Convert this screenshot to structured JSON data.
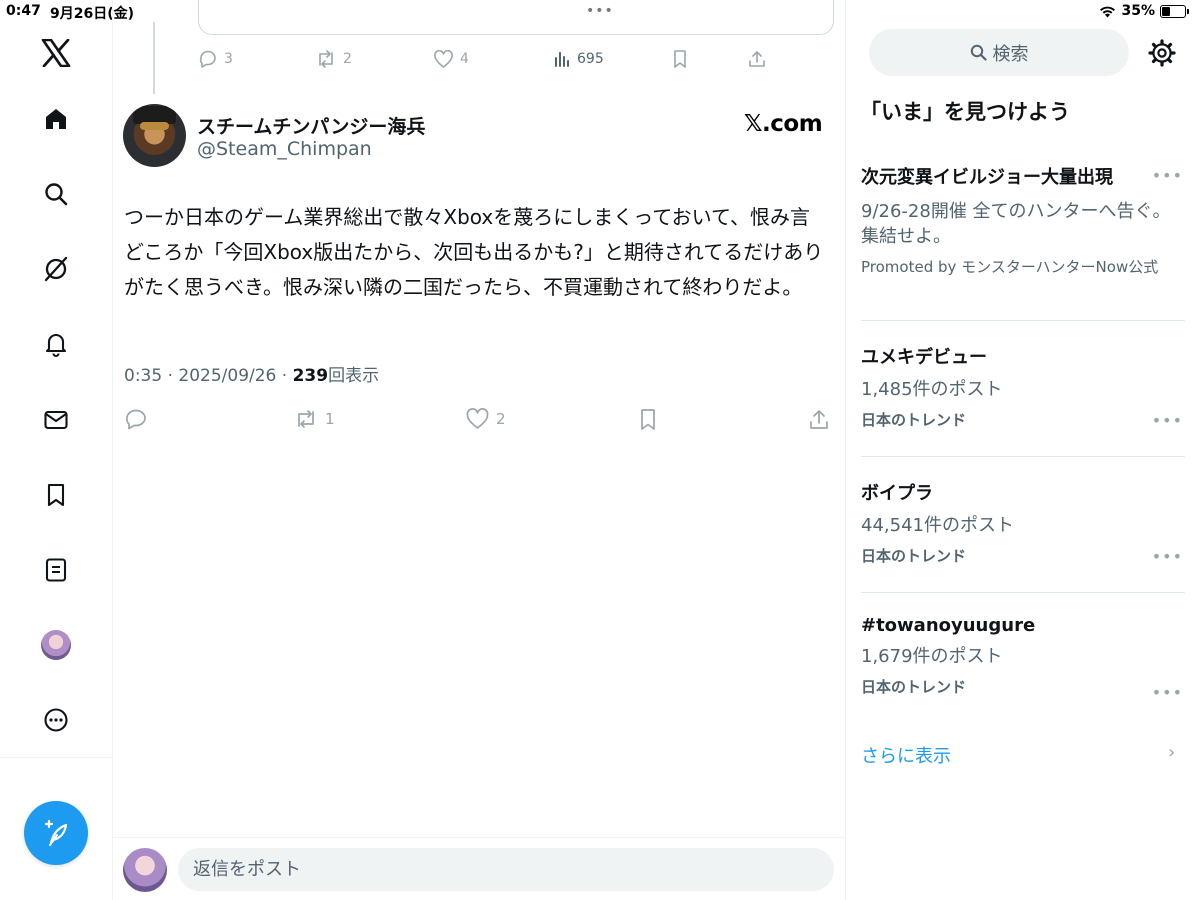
{
  "status_bar": {
    "time": "0:47",
    "date": "9月26日(金)",
    "battery": "35%",
    "battery_level": 0.35,
    "top_dots": "•••"
  },
  "nav": {
    "items": [
      "x-logo",
      "home",
      "explore",
      "grok",
      "notifications",
      "messages",
      "bookmarks",
      "lists",
      "profile",
      "more"
    ]
  },
  "prev_tweet_actions": {
    "replies": "3",
    "reposts": "2",
    "likes": "4",
    "views": "695"
  },
  "tweet": {
    "display_name": "スチームチンパンジー海兵",
    "handle": "@Steam_Chimpan",
    "brand": "𝕏.com",
    "text": "つーか日本のゲーム業界総出で散々Xboxを蔑ろにしまくっておいて、恨み言どころか「今回Xbox版出たから、次回も出るかも?」と期待されてるだけありがたく思うべき。恨み深い隣の二国だったら、不買運動されて終わりだよ。",
    "meta_time": "0:35 · 2025/09/26 · ",
    "views_count": "239",
    "views_label": "回表示",
    "actions": {
      "replies": "",
      "reposts": "1",
      "likes": "2"
    }
  },
  "reply": {
    "placeholder": "返信をポスト"
  },
  "sidebar": {
    "search_placeholder": "検索",
    "title": "「いま」を見つけよう",
    "trends": [
      {
        "name": "次元変異イビルジョー大量出現",
        "sub": "9/26-28開催 全てのハンターへ告ぐ。集結せよ。",
        "meta": "Promoted by モンスターハンターNow公式"
      },
      {
        "name": "ユメキデビュー",
        "sub": "1,485件のポスト",
        "meta": "日本のトレンド"
      },
      {
        "name": "ボイプラ",
        "sub": "44,541件のポスト",
        "meta": "日本のトレンド"
      },
      {
        "name": "#towanoyuugure",
        "sub": "1,679件のポスト",
        "meta": "日本のトレンド"
      }
    ],
    "more_glyph": "•••",
    "show_more": "さらに表示",
    "show_more_chevron": "›"
  },
  "colors": {
    "accent": "#1d9bf0",
    "text_primary": "#0f1419",
    "text_secondary": "#536471"
  }
}
